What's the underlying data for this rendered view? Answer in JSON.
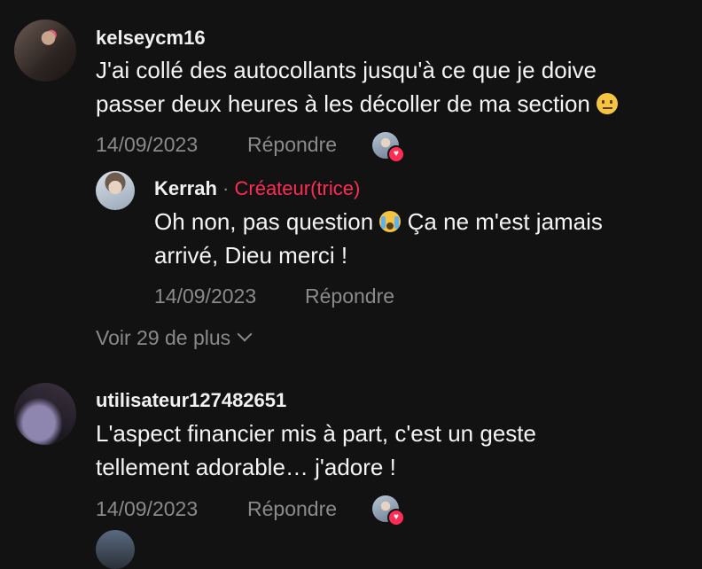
{
  "comments": [
    {
      "username": "kelseycm16",
      "text_line1": "J'ai collé des autocollants jusqu'à ce que je doive",
      "text_line2": "passer deux heures à les décoller de ma section",
      "emoji": "neutral-face-emoji",
      "date": "14/09/2023",
      "reply_label": "Répondre",
      "liked_by_creator": true
    },
    {
      "username": "utilisateur127482651",
      "text_line1": "L'aspect financier mis à part, c'est un geste",
      "text_line2": "tellement adorable… j'adore !",
      "date": "14/09/2023",
      "reply_label": "Répondre",
      "liked_by_creator": true
    }
  ],
  "reply": {
    "username": "Kerrah",
    "separator": "·",
    "creator_label": "Créateur(trice)",
    "text_line1_a": "Oh non, pas question",
    "text_line1_b": "Ça ne m'est jamais",
    "text_line2": "arrivé, Dieu merci !",
    "emoji": "crying-face-emoji",
    "date": "14/09/2023",
    "reply_label": "Répondre"
  },
  "view_more": "Voir 29 de plus",
  "colors": {
    "background": "#121212",
    "creator": "#fe2c55",
    "muted": "#8a8a8a",
    "heart": "#ff2d55"
  }
}
